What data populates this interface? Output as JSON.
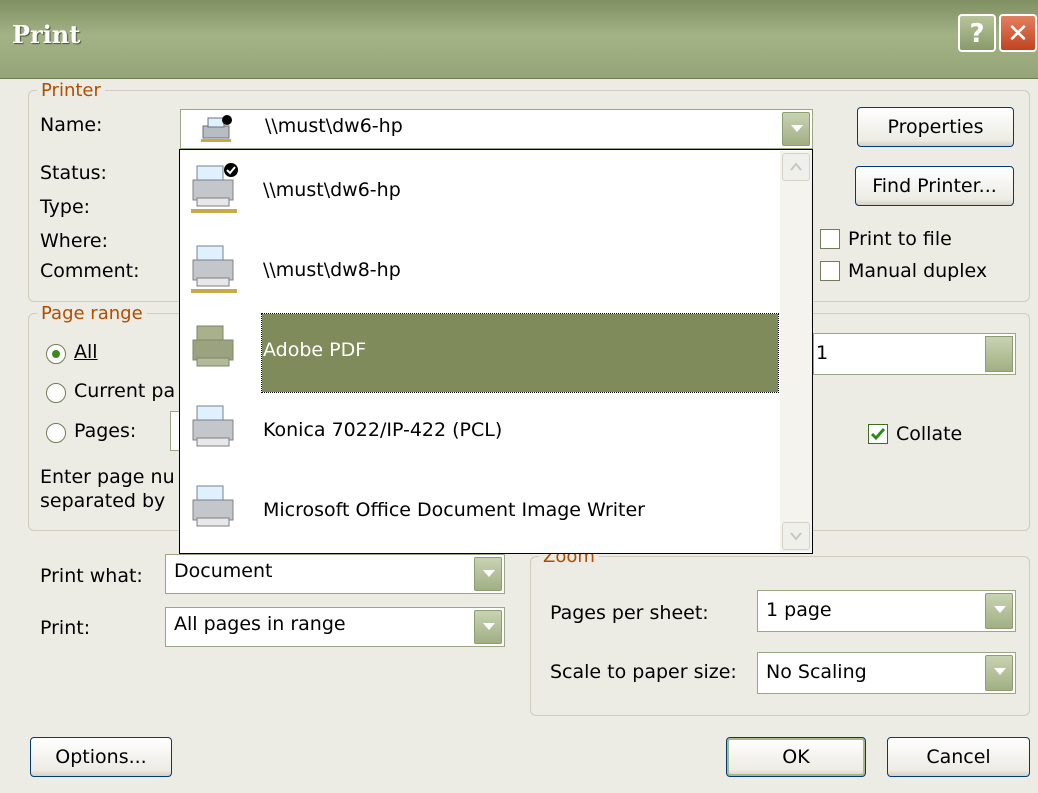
{
  "window": {
    "title": "Print",
    "help_glyph": "?",
    "close_glyph": "✕"
  },
  "printer": {
    "legend": "Printer",
    "name_label": "Name:",
    "status_label": "Status:",
    "type_label": "Type:",
    "where_label": "Where:",
    "comment_label": "Comment:",
    "selected_name": "\\\\must\\dw6-hp",
    "properties_button": "Properties",
    "find_printer_button": "Find Printer...",
    "print_to_file": {
      "label": "Print to file",
      "checked": false
    },
    "manual_duplex": {
      "label": "Manual duplex",
      "checked": false
    },
    "dropdown_items": [
      {
        "label": "\\\\must\\dw6-hp",
        "icon": "network-printer-default-icon",
        "selected": false
      },
      {
        "label": "\\\\must\\dw8-hp",
        "icon": "network-printer-icon",
        "selected": false
      },
      {
        "label": "Adobe PDF",
        "icon": "printer-icon",
        "selected": true
      },
      {
        "label": "Konica 7022/IP-422 (PCL)",
        "icon": "printer-icon",
        "selected": false
      },
      {
        "label": "Microsoft Office Document Image Writer",
        "icon": "printer-icon",
        "selected": false
      }
    ]
  },
  "page_range": {
    "legend": "Page range",
    "all_label": "All",
    "current_label_visible": "Current pa",
    "pages_label": "Pages:",
    "help_line1": "Enter page nu",
    "help_line2": "separated by",
    "selected": "All"
  },
  "copies": {
    "value": "1",
    "collate_label": "Collate",
    "collate_checked": true
  },
  "print_what": {
    "label": "Print what:",
    "value": "Document"
  },
  "print": {
    "label": "Print:",
    "value": "All pages in range"
  },
  "zoom": {
    "legend": "Zoom",
    "pages_per_sheet_label": "Pages per sheet:",
    "pages_per_sheet_value": "1 page",
    "scale_label": "Scale to paper size:",
    "scale_value": "No Scaling"
  },
  "footer": {
    "options_button": "Options...",
    "ok_button": "OK",
    "cancel_button": "Cancel"
  }
}
